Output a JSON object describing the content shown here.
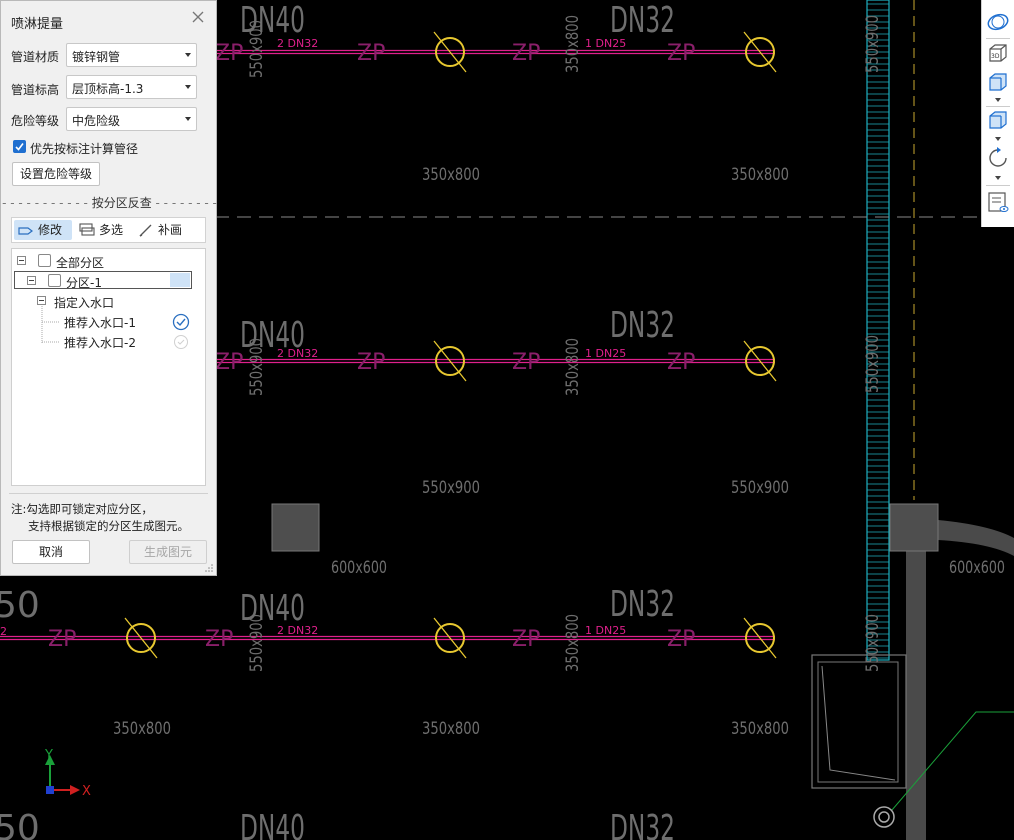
{
  "dialog": {
    "title": "喷淋提量",
    "fields": [
      {
        "label": "管道材质",
        "value": "镀锌钢管"
      },
      {
        "label": "管道标高",
        "value": "层顶标高-1.3"
      },
      {
        "label": "危险等级",
        "value": "中危险级"
      }
    ],
    "priority_checkbox_label": "优先按标注计算管径",
    "priority_checked": true,
    "set_hazard_button": "设置危险等级",
    "section_title": "按分区反查",
    "tools": [
      "修改",
      "多选",
      "补画"
    ],
    "tree": {
      "all_label": "全部分区",
      "zone_label": "分区-1",
      "inlet_group_label": "指定入水口",
      "inlets": [
        "推荐入水口-1",
        "推荐入水口-2"
      ]
    },
    "note_line1": "注:勾选即可锁定对应分区，",
    "note_line2": "支持根据锁定的分区生成图元。",
    "cancel_button": "取消",
    "generate_button": "生成图元"
  },
  "drawing": {
    "pipe_sizes": [
      "DN40",
      "DN32",
      "DN40",
      "DN32",
      "DN40",
      "DN32",
      "DN40",
      "DN32"
    ],
    "pipe_labels": [
      "2 DN32",
      "1 DN25",
      "2 DN32",
      "1 DN25",
      "2 DN32",
      "1 DN25"
    ],
    "zp": "ZP",
    "beams": [
      "350x800",
      "350x800",
      "550x900",
      "550x900",
      "350x800",
      "350x800",
      "350x800"
    ],
    "beams_vertical": [
      "550x900",
      "350x800",
      "550x900",
      "550x900",
      "350x800",
      "550x900",
      "550x900",
      "350x800",
      "550x900"
    ],
    "columns": [
      "600x600",
      "600x600"
    ],
    "partial_left": [
      "50",
      "2",
      "50"
    ],
    "axis_x": "X",
    "axis_y": "Y",
    "colors": {
      "pipe": "#e0208c",
      "sprinkler": "#e8c830",
      "text": "#6e6e6e",
      "cyan": "#1fb0c0"
    }
  }
}
